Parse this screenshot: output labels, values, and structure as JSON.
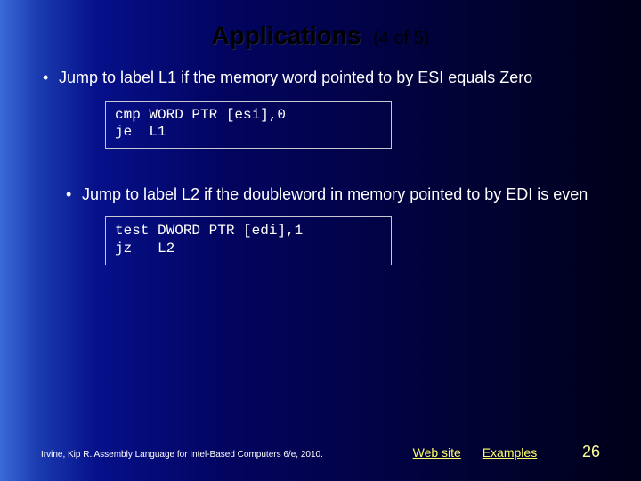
{
  "title": {
    "main": "Applications",
    "sub": "(4 of 5)"
  },
  "bullets": {
    "item1": {
      "text": "Jump to label L1 if the memory word pointed to by ESI equals Zero",
      "code": "cmp WORD PTR [esi],0\nje  L1"
    },
    "item2": {
      "text": "Jump to label L2 if the doubleword in memory pointed to by EDI is even",
      "code": "test DWORD PTR [edi],1\njz   L2"
    }
  },
  "footer": {
    "citation": "Irvine, Kip R. Assembly Language for Intel-Based Computers 6/e, 2010.",
    "link1": "Web site",
    "link2": "Examples",
    "page": "26"
  }
}
